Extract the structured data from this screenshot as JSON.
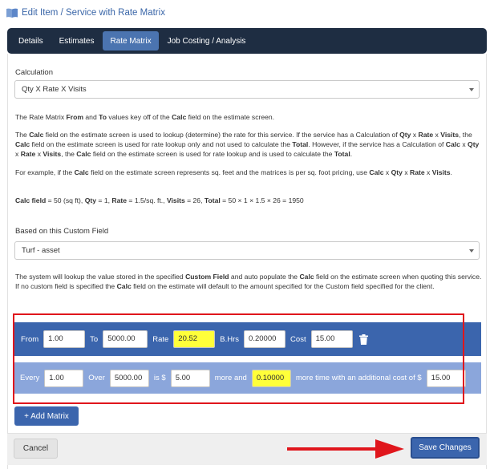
{
  "page": {
    "title": "Edit Item / Service with Rate Matrix"
  },
  "tabs": [
    {
      "label": "Details",
      "active": false
    },
    {
      "label": "Estimates",
      "active": false
    },
    {
      "label": "Rate Matrix",
      "active": true
    },
    {
      "label": "Job Costing / Analysis",
      "active": false
    }
  ],
  "calculation": {
    "label": "Calculation",
    "selected": "Qty X Rate X Visits"
  },
  "info": {
    "p1": [
      "The Rate Matrix ",
      "From",
      " and ",
      "To",
      " values key off of the ",
      "Calc",
      " field on the estimate screen."
    ],
    "p2": [
      "The ",
      "Calc",
      " field on the estimate screen is used to lookup (determine) the rate for this service. If the service has a Calculation of ",
      "Qty",
      " x ",
      "Rate",
      " x ",
      "Visits",
      ", the ",
      "Calc",
      " field on the estimate screen is used for rate lookup only and not used to calculate the ",
      "Total",
      ". However, if the service has a Calculation of ",
      "Calc",
      " x ",
      "Qty",
      " x ",
      "Rate",
      " x ",
      "Visits",
      ", the ",
      "Calc",
      " field on the estimate screen is used for rate lookup and is used to calculate the ",
      "Total",
      "."
    ],
    "p3": [
      "For example, if the ",
      "Calc",
      " field on the estimate screen represents sq. feet and the matrices is per sq. foot pricing, use ",
      "Calc",
      " x ",
      "Qty",
      " x ",
      "Rate",
      " x ",
      "Visits",
      "."
    ],
    "p4": [
      "Calc field",
      " = 50 (sq ft), ",
      "Qty",
      " = 1, ",
      "Rate",
      " = 1.5/sq. ft., ",
      "Visits",
      " = 26, ",
      "Total",
      " = 50 × 1 × 1.5 × 26 = 1950"
    ]
  },
  "custom_field": {
    "label": "Based on this Custom Field",
    "selected": "Turf - asset",
    "description": [
      "The system will lookup the value stored in the specified ",
      "Custom Field",
      " and auto populate the ",
      "Calc",
      " field on the estimate screen when quoting this service. If no custom field is specified the ",
      "Calc",
      " field on the estimate will default to the amount specified for the Custom field specified for the client."
    ]
  },
  "matrix": {
    "from_label": "From",
    "from_value": "1.00",
    "to_label": "To",
    "to_value": "5000.00",
    "rate_label": "Rate",
    "rate_value": "20.52",
    "bhrs_label": "B.Hrs",
    "bhrs_value": "0.20000",
    "cost_label": "Cost",
    "cost_value": "15.00",
    "every_label": "Every",
    "every_value": "1.00",
    "over_label": "Over",
    "over_value": "5000.00",
    "is_label": "is $",
    "is_value": "5.00",
    "more_label": "more and",
    "more_value": "0.10000",
    "extra_label": "more time with an additional cost of $",
    "extra_value": "15.00"
  },
  "buttons": {
    "add_matrix": "+ Add Matrix",
    "cancel": "Cancel",
    "save": "Save Changes"
  },
  "colors": {
    "accent": "#3b65ad",
    "tabbar": "#1e2d42",
    "highlight": "#ffff3a",
    "annotation": "#e0161c"
  }
}
